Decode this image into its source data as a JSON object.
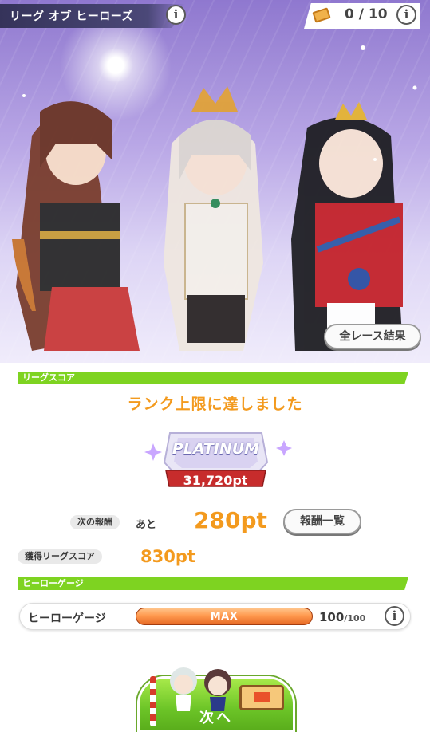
{
  "header": {
    "title": "リーグ オブ ヒーローズ",
    "info_glyph": "i",
    "ticket_count": "0 / 10"
  },
  "hero": {
    "all_results_label": "全レース結果"
  },
  "league_score": {
    "section_label": "リーグスコア",
    "rank_message": "ランク上限に達しました",
    "rank_name": "PLATINUM",
    "rank_score": "31,720pt",
    "next_reward_label": "次の報酬",
    "remaining_prefix": "あと",
    "remaining_points": "280pt",
    "reward_list_label": "報酬一覧",
    "earned_label": "獲得リーグスコア",
    "earned_points": "830pt"
  },
  "hero_gauge": {
    "section_label": "ヒーローゲージ",
    "label": "ヒーローゲージ",
    "status_text": "MAX",
    "current": "100",
    "max": "/100",
    "fill_fraction": 1.0
  },
  "footer": {
    "next_label": "次へ"
  },
  "colors": {
    "accent_green": "#7ed321",
    "points_orange": "#f39a1e",
    "gauge_orange": "#ff9a4f"
  }
}
